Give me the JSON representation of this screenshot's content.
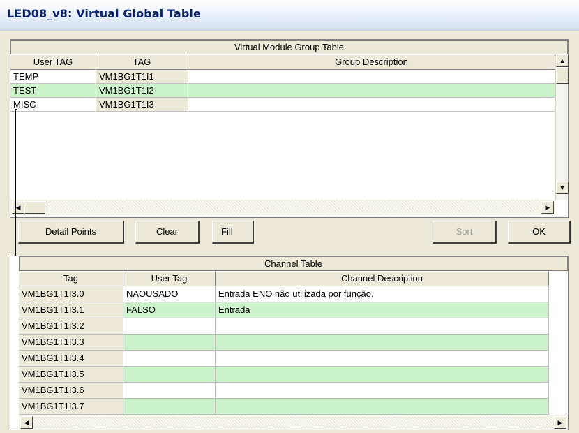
{
  "window": {
    "title": "LED08_v8: Virtual Global Table"
  },
  "group_table": {
    "caption": "Virtual Module Group Table",
    "columns": [
      "User TAG",
      "TAG",
      "Group Description"
    ],
    "rows": [
      {
        "user_tag": "TEMP",
        "tag": "VM1BG1T1I1",
        "description": "",
        "highlight": false
      },
      {
        "user_tag": "TEST",
        "tag": "VM1BG1T1I2",
        "description": "",
        "highlight": true
      },
      {
        "user_tag": "MISC",
        "tag": "VM1BG1T1I3",
        "description": "",
        "highlight": false
      }
    ]
  },
  "buttons": {
    "detail_points": "Detail Points",
    "clear": "Clear",
    "fill": "Fill",
    "sort": "Sort",
    "ok": "OK"
  },
  "channel_table": {
    "caption": "Channel Table",
    "columns": [
      "Tag",
      "User Tag",
      "Channel Description"
    ],
    "rows": [
      {
        "tag": "VM1BG1T1I3.0",
        "user_tag": "NAOUSADO",
        "description": "Entrada ENO não utilizada por função.",
        "highlight": false
      },
      {
        "tag": "VM1BG1T1I3.1",
        "user_tag": "FALSO",
        "description": "Entrada",
        "highlight": true
      },
      {
        "tag": "VM1BG1T1I3.2",
        "user_tag": "",
        "description": "",
        "highlight": false
      },
      {
        "tag": "VM1BG1T1I3.3",
        "user_tag": "",
        "description": "",
        "highlight": true
      },
      {
        "tag": "VM1BG1T1I3.4",
        "user_tag": "",
        "description": "",
        "highlight": false
      },
      {
        "tag": "VM1BG1T1I3.5",
        "user_tag": "",
        "description": "",
        "highlight": true
      },
      {
        "tag": "VM1BG1T1I3.6",
        "user_tag": "",
        "description": "",
        "highlight": false
      },
      {
        "tag": "VM1BG1T1I3.7",
        "user_tag": "",
        "description": "",
        "highlight": true
      }
    ]
  },
  "colors": {
    "highlight_row": "#CCF2CC",
    "face": "#ECE9D8",
    "title_text": "#0A246A"
  }
}
